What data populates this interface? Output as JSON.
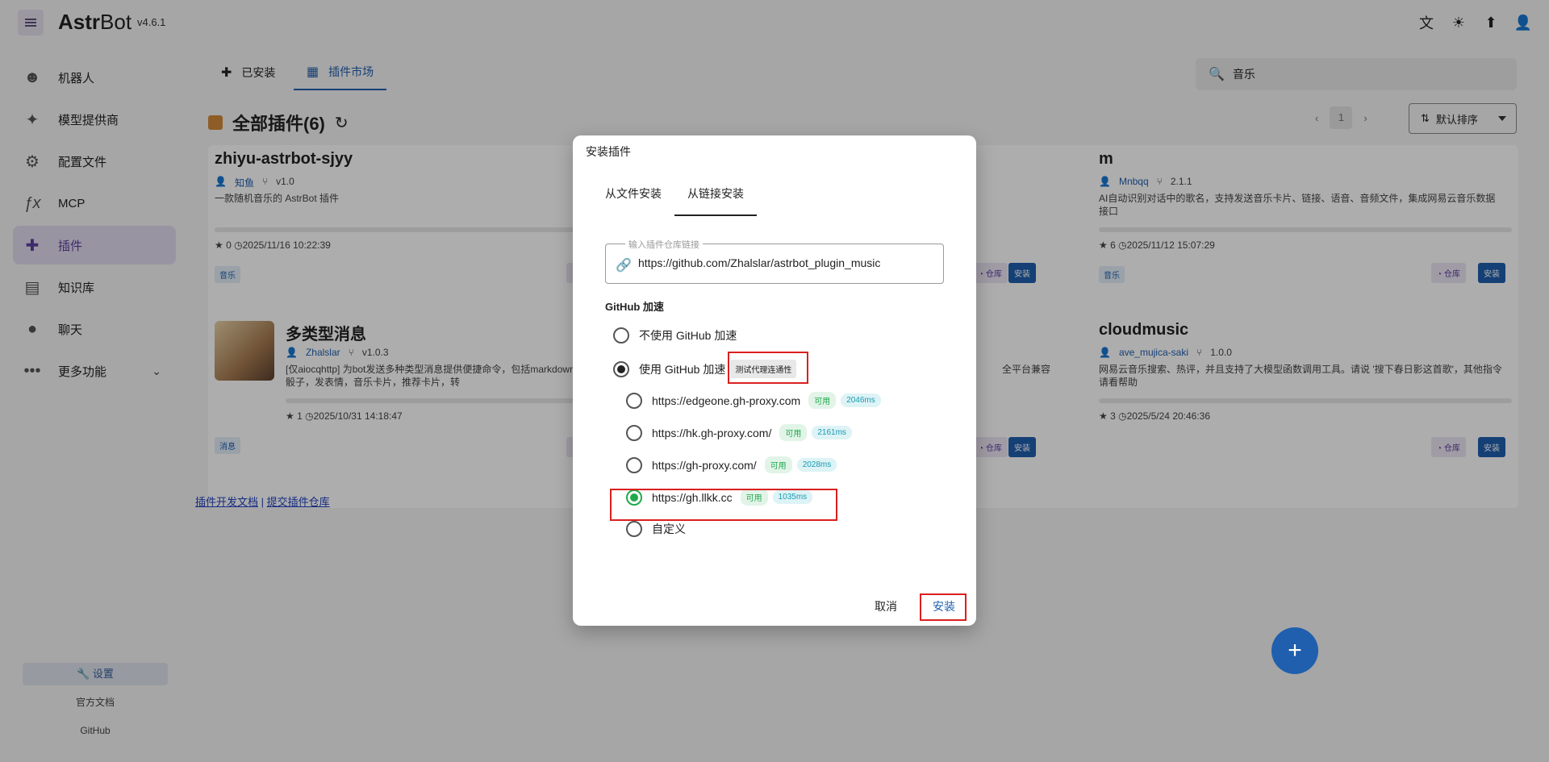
{
  "app": {
    "brand_bold": "Astr",
    "brand_light": "Bot",
    "version": "v4.6.1"
  },
  "sidebar": {
    "items": [
      {
        "label": "机器人"
      },
      {
        "label": "模型提供商"
      },
      {
        "label": "配置文件"
      },
      {
        "label": "MCP"
      },
      {
        "label": "插件"
      },
      {
        "label": "知识库"
      },
      {
        "label": "聊天"
      },
      {
        "label": "更多功能"
      }
    ],
    "settings": "设置",
    "docs": "官方文档",
    "github": "GitHub"
  },
  "tabs": {
    "installed": "已安装",
    "market": "插件市场"
  },
  "search": {
    "value": "音乐"
  },
  "section": {
    "title": "全部插件(6)"
  },
  "pager": {
    "page": "1"
  },
  "sort": {
    "label": "默认排序"
  },
  "cards": [
    {
      "name": "zhiyu-astrbot-sjyy",
      "author": "知鱼",
      "version": "v1.0",
      "desc": "一款随机音乐的 AstrBot 插件",
      "stars": "★ 0",
      "date": "2025/11/16 10:22:39",
      "tag": "音乐"
    },
    {
      "name": "m",
      "author": "Mnbqq",
      "version": "2.1.1",
      "desc": "AI自动识别对话中的歌名，支持发送音乐卡片、链接、语音、音频文件，集成网易云音乐数据接口",
      "stars": "★ 6",
      "date": "2025/11/12 15:07:29",
      "tag": "音乐"
    },
    {
      "name": "多类型消息",
      "author": "Zhalslar",
      "version": "v1.0.3",
      "desc": "[仅aiocqhttp] 为bot发送多种类型消息提供便捷命令，包括markdown，猜拳，骰骰子，发表情，音乐卡片，推荐卡片，转",
      "stars": "★ 1",
      "date": "2025/10/31 14:18:47",
      "tag": "消息"
    },
    {
      "name": "cloudmusic",
      "author": "ave_mujica-saki",
      "version": "1.0.0",
      "desc": "网易云音乐搜索、热评，并且支持了大模型函数调用工具。请说 '搜下春日影这首歌'，其他指令请看帮助",
      "stars": "★ 3",
      "date": "2025/5/24 20:46:36",
      "tag": ""
    }
  ],
  "card_mid_fragment": "全平台兼容",
  "card_buttons": {
    "repo": "仓库",
    "install": "安装"
  },
  "links": {
    "dev_docs": "插件开发文档",
    "separator": "|",
    "submit": "提交插件仓库"
  },
  "fab": {
    "label": "+"
  },
  "dialog": {
    "title": "安装插件",
    "tab_file": "从文件安装",
    "tab_link": "从链接安装",
    "field_legend": "输入插件仓库链接",
    "field_value": "https://github.com/Zhalslar/astrbot_plugin_music",
    "gh_label": "GitHub 加速",
    "no_accel": "不使用 GitHub 加速",
    "use_accel": "使用 GitHub 加速",
    "test_btn": "测试代理连通性",
    "proxies": [
      {
        "url": "https://edgeone.gh-proxy.com",
        "status": "可用",
        "ms": "2046ms"
      },
      {
        "url": "https://hk.gh-proxy.com/",
        "status": "可用",
        "ms": "2161ms"
      },
      {
        "url": "https://gh-proxy.com/",
        "status": "可用",
        "ms": "2028ms"
      },
      {
        "url": "https://gh.llkk.cc",
        "status": "可用",
        "ms": "1035ms"
      }
    ],
    "custom": "自定义",
    "cancel": "取消",
    "install": "安装"
  },
  "colors": {
    "accent": "#1f5fae",
    "active_nav": "#5b3fa0",
    "highlight": "#d9201f",
    "selected_radio": "#1faa4a"
  }
}
